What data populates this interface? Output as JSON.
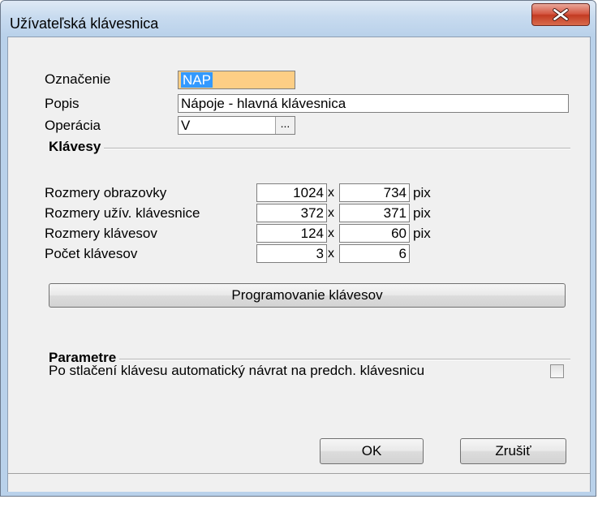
{
  "window": {
    "title": "Užívateľská klávesnica",
    "close_icon": "close-icon"
  },
  "form": {
    "oznacenie_label": "Označenie",
    "oznacenie_value": "NAP",
    "popis_label": "Popis",
    "popis_value": "Nápoje - hlavná klávesnica",
    "operacia_label": "Operácia",
    "operacia_value": "V",
    "operacia_browse": "..."
  },
  "klavesy": {
    "title": "Klávesy",
    "separator": "x",
    "rows": [
      {
        "label": "Rozmery obrazovky",
        "a": "1024",
        "b": "734",
        "unit": "pix"
      },
      {
        "label": "Rozmery užív. klávesnice",
        "a": "372",
        "b": "371",
        "unit": "pix"
      },
      {
        "label": "Rozmery klávesov",
        "a": "124",
        "b": "60",
        "unit": "pix"
      },
      {
        "label": "Počet klávesov",
        "a": "3",
        "b": "6",
        "unit": ""
      }
    ],
    "program_button": "Programovanie klávesov"
  },
  "parametre": {
    "title": "Parametre",
    "auto_return_label": "Po stlačení klávesu automatický návrat na predch. klávesnicu",
    "auto_return_checked": false
  },
  "buttons": {
    "ok": "OK",
    "cancel": "Zrušiť"
  },
  "colors": {
    "accent_field": "#fdce85",
    "selection": "#3399ff",
    "close_button": "#c23a22"
  }
}
